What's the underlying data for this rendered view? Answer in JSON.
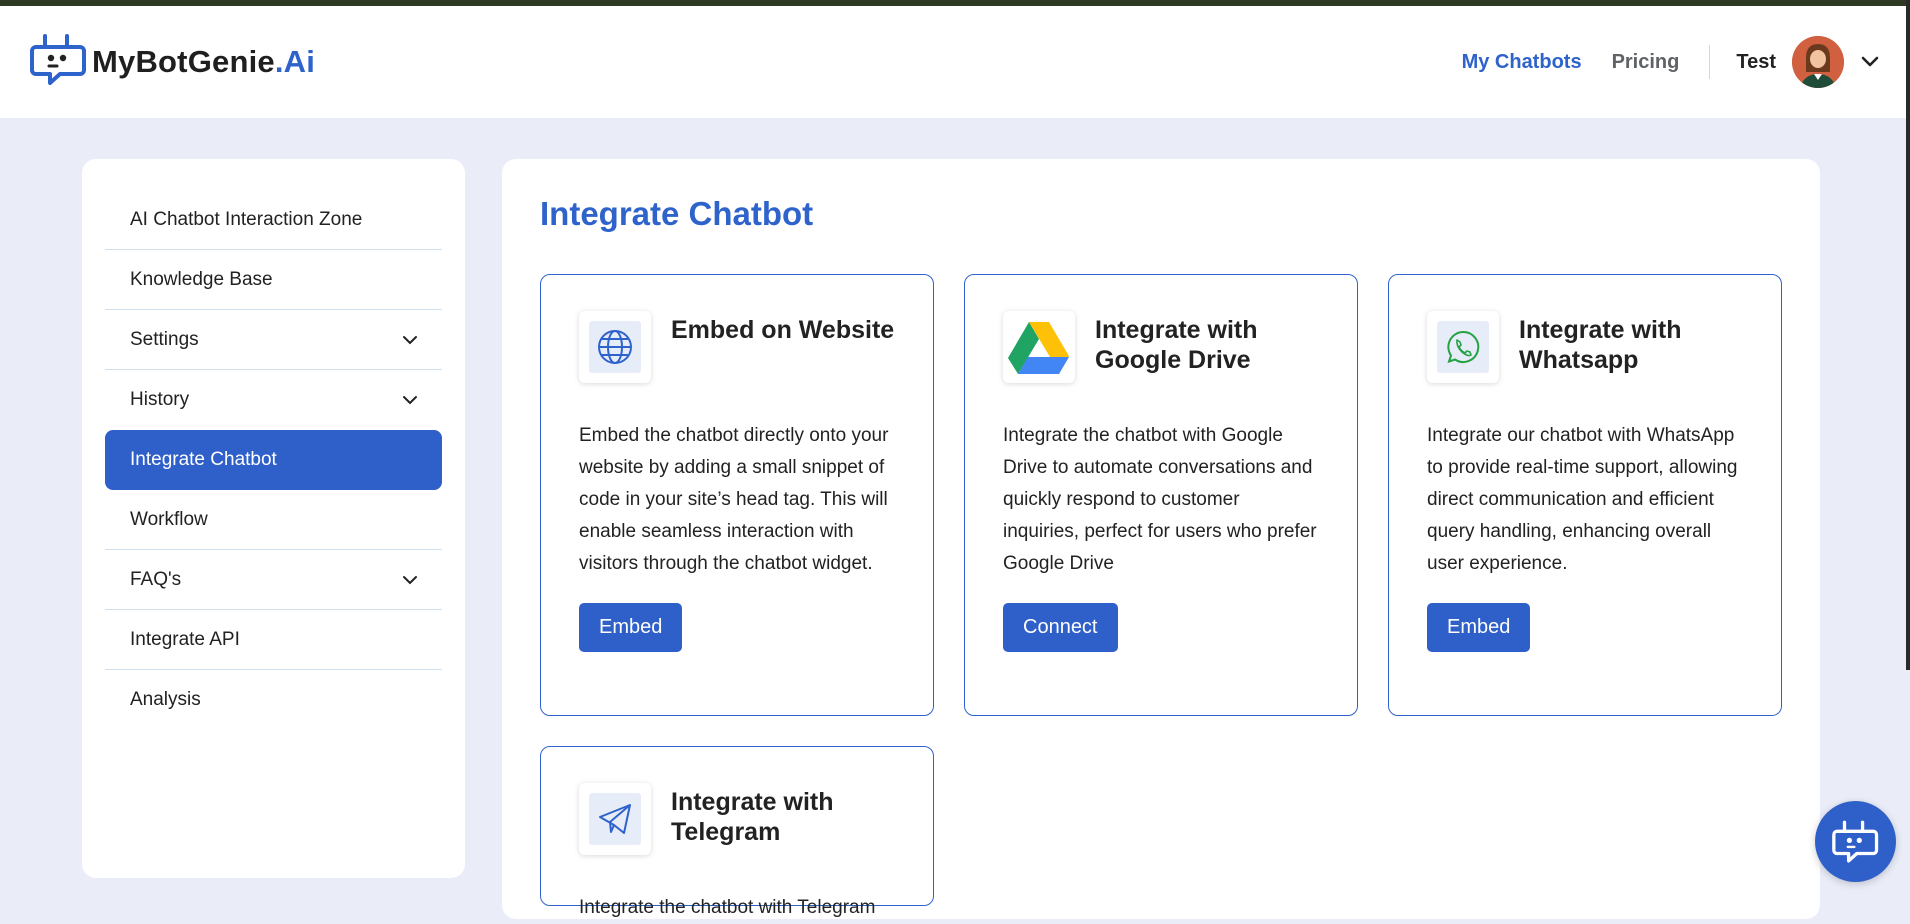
{
  "brand": {
    "name_main": "MyBotGenie",
    "name_accent": ".Ai",
    "logo_icon": "robot-chat-icon"
  },
  "nav": {
    "my_chatbots": "My Chatbots",
    "pricing": "Pricing",
    "user_name": "Test",
    "avatar_icon": "user-avatar",
    "dropdown_icon": "chevron-down-icon"
  },
  "sidebar": {
    "items": [
      {
        "label": "AI Chatbot Interaction Zone",
        "has_dropdown": false
      },
      {
        "label": "Knowledge Base",
        "has_dropdown": false
      },
      {
        "label": "Settings",
        "has_dropdown": true
      },
      {
        "label": "History",
        "has_dropdown": true
      },
      {
        "label": "Integrate Chatbot",
        "has_dropdown": false,
        "active": true
      },
      {
        "label": "Workflow",
        "has_dropdown": false
      },
      {
        "label": "FAQ's",
        "has_dropdown": true
      },
      {
        "label": "Integrate API",
        "has_dropdown": false
      },
      {
        "label": "Analysis",
        "has_dropdown": false
      }
    ]
  },
  "main": {
    "title": "Integrate Chatbot",
    "cards": [
      {
        "title": "Embed on Website",
        "icon": "globe-icon",
        "description": "Embed the chatbot directly onto your website by adding a small snippet of code in your site’s head tag. This will enable seamless interaction with visitors through the chatbot widget.",
        "button": "Embed"
      },
      {
        "title": "Integrate with Google Drive",
        "icon": "google-drive-icon",
        "description": "Integrate the chatbot with Google Drive to automate conversations and quickly respond to customer inquiries, perfect for users who prefer Google Drive",
        "button": "Connect"
      },
      {
        "title": "Integrate with Whatsapp",
        "icon": "whatsapp-icon",
        "description": "Integrate our chatbot with WhatsApp to provide real-time support, allowing direct communication and efficient query handling, enhancing overall user experience.",
        "button": "Embed"
      },
      {
        "title": "Integrate with Telegram",
        "icon": "telegram-icon",
        "description": "Integrate the chatbot with Telegram"
      }
    ]
  },
  "colors": {
    "accent": "#2f63cc",
    "background": "#eaedf8",
    "active_item": "#2f5fc9"
  },
  "fab": {
    "icon": "chatbot-launcher-icon"
  }
}
